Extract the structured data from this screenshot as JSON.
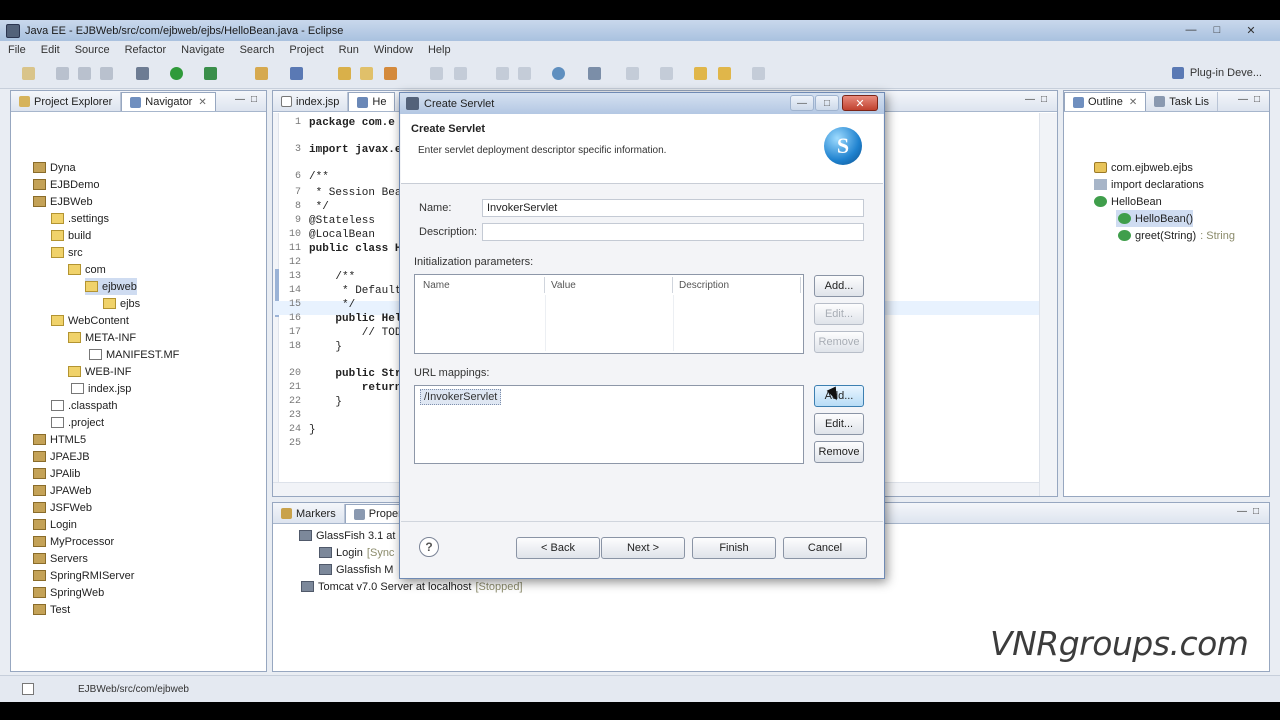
{
  "window": {
    "title": "Java EE - EJBWeb/src/com/ejbweb/ejbs/HelloBean.java - Eclipse",
    "min": "—",
    "max": "□",
    "close": "✕"
  },
  "menu": [
    "File",
    "Edit",
    "Source",
    "Refactor",
    "Navigate",
    "Search",
    "Project",
    "Run",
    "Window",
    "Help"
  ],
  "toolbar": {
    "perspective": "Plug-in Deve..."
  },
  "left_panel": {
    "tabs": [
      {
        "label": "Project Explorer"
      },
      {
        "label": "Navigator",
        "close": "✕"
      }
    ],
    "tree": [
      {
        "label": "Dyna",
        "icon": "project-icon"
      },
      {
        "label": "EJBDemo",
        "icon": "project-icon"
      },
      {
        "label": "EJBWeb",
        "icon": "project-icon"
      },
      {
        "label": ".settings",
        "icon": "folder-icon"
      },
      {
        "label": "build",
        "icon": "folder-icon"
      },
      {
        "label": "src",
        "icon": "folder-icon"
      },
      {
        "label": "com",
        "icon": "folder-icon"
      },
      {
        "label": "ejbweb",
        "icon": "folder-icon"
      },
      {
        "label": "ejbs",
        "icon": "folder-icon"
      },
      {
        "label": "WebContent",
        "icon": "folder-icon"
      },
      {
        "label": "META-INF",
        "icon": "folder-icon"
      },
      {
        "label": "MANIFEST.MF",
        "icon": "file-icon"
      },
      {
        "label": "WEB-INF",
        "icon": "folder-icon"
      },
      {
        "label": "index.jsp",
        "icon": "file-icon"
      },
      {
        "label": ".classpath",
        "icon": "xfile-icon"
      },
      {
        "label": ".project",
        "icon": "xfile-icon"
      },
      {
        "label": "HTML5",
        "icon": "project-icon"
      },
      {
        "label": "JPAEJB",
        "icon": "project-icon"
      },
      {
        "label": "JPAlib",
        "icon": "project-icon"
      },
      {
        "label": "JPAWeb",
        "icon": "project-icon"
      },
      {
        "label": "JSFWeb",
        "icon": "project-icon"
      },
      {
        "label": "Login",
        "icon": "project-icon"
      },
      {
        "label": "MyProcessor",
        "icon": "project-icon"
      },
      {
        "label": "Servers",
        "icon": "project-icon"
      },
      {
        "label": "SpringRMIServer",
        "icon": "project-icon"
      },
      {
        "label": "SpringWeb",
        "icon": "project-icon"
      },
      {
        "label": "Test",
        "icon": "project-icon"
      }
    ]
  },
  "editor": {
    "tabs": [
      {
        "label": "index.jsp"
      },
      {
        "label": "He"
      }
    ],
    "lines": [
      {
        "n": "1",
        "code": "package com.e"
      },
      {
        "n": "3",
        "code": "import javax.e"
      },
      {
        "n": "6",
        "code": "/**"
      },
      {
        "n": "7",
        "code": " * Session Bea"
      },
      {
        "n": "8",
        "code": " */"
      },
      {
        "n": "9",
        "code": "@Stateless"
      },
      {
        "n": "10",
        "code": "@LocalBean"
      },
      {
        "n": "11",
        "code": "public class H"
      },
      {
        "n": "12",
        "code": ""
      },
      {
        "n": "13",
        "code": "    /**"
      },
      {
        "n": "14",
        "code": "     * Default"
      },
      {
        "n": "15",
        "code": "     */"
      },
      {
        "n": "16",
        "code": "    public Hel"
      },
      {
        "n": "17",
        "code": "        // TOD"
      },
      {
        "n": "18",
        "code": "    }"
      },
      {
        "n": "20",
        "code": "    public Str"
      },
      {
        "n": "21",
        "code": "        return"
      },
      {
        "n": "22",
        "code": "    }"
      },
      {
        "n": "23",
        "code": ""
      },
      {
        "n": "24",
        "code": "}"
      },
      {
        "n": "25",
        "code": ""
      }
    ]
  },
  "outline": {
    "tabs": [
      {
        "label": "Outline",
        "close": "✕"
      },
      {
        "label": "Task Lis"
      }
    ],
    "tree": [
      {
        "label": "com.ejbweb.ejbs",
        "extra": ""
      },
      {
        "label": "import declarations",
        "extra": ""
      },
      {
        "label": "HelloBean",
        "extra": ""
      },
      {
        "label": "HelloBean()",
        "extra": ""
      },
      {
        "label": "greet(String)",
        "extra": ": String"
      }
    ]
  },
  "bottom_panel": {
    "tabs": [
      {
        "label": "Markers"
      },
      {
        "label": "Propert"
      }
    ],
    "tree": [
      {
        "label": "GlassFish 3.1 at l",
        "extra": ""
      },
      {
        "label": "Login",
        "extra": "[Sync"
      },
      {
        "label": "Glassfish M",
        "extra": ""
      },
      {
        "label": "Tomcat v7.0 Server at localhost",
        "extra": "[Stopped]"
      }
    ]
  },
  "dialog": {
    "title": "Create Servlet",
    "heading": "Create Servlet",
    "description": "Enter servlet deployment descriptor specific information.",
    "logo_letter": "S",
    "name_label": "Name:",
    "name_value": "InvokerServlet",
    "description_label": "Description:",
    "description_value": "",
    "init_params_label": "Initialization parameters:",
    "init_params_columns": [
      "Name",
      "Value",
      "Description"
    ],
    "init_buttons": {
      "add": "Add...",
      "edit": "Edit...",
      "remove": "Remove"
    },
    "url_label": "URL mappings:",
    "url_mappings": [
      "/InvokerServlet"
    ],
    "url_buttons": {
      "add": "Add...",
      "edit": "Edit...",
      "remove": "Remove"
    },
    "help": "?",
    "back": "< Back",
    "next": "Next >",
    "finish": "Finish",
    "cancel": "Cancel"
  },
  "status": {
    "path": "EJBWeb/src/com/ejbweb"
  },
  "watermark": "VNRgroups.com"
}
